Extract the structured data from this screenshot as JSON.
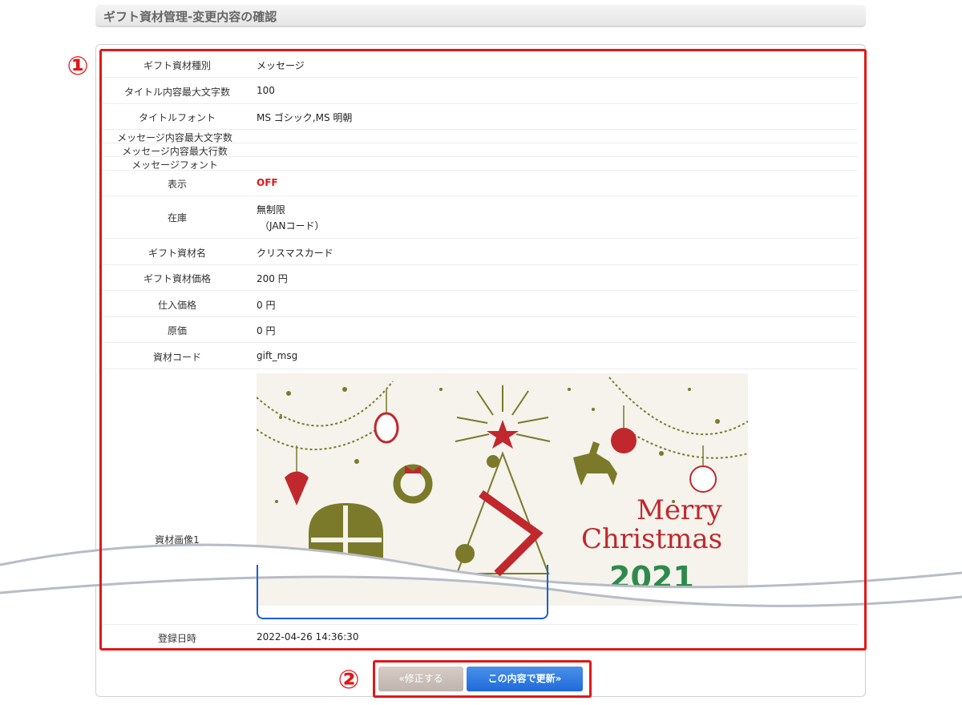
{
  "header": {
    "title": "ギフト資材管理-変更内容の確認"
  },
  "callouts": {
    "one": "①",
    "two": "②"
  },
  "rows": [
    {
      "label": "ギフト資材種別",
      "value": "メッセージ"
    },
    {
      "label": "タイトル内容最大文字数",
      "value": "100"
    },
    {
      "label": "タイトルフォント",
      "value": "MS ゴシック,MS 明朝"
    },
    {
      "label": "メッセージ内容最大文字数",
      "value": ""
    },
    {
      "label": "メッセージ内容最大行数",
      "value": ""
    },
    {
      "label": "メッセージフォント",
      "value": ""
    },
    {
      "label": "表示",
      "value": "OFF"
    },
    {
      "label": "在庫",
      "value": "無制限",
      "sub": "（JANコード）"
    },
    {
      "label": "ギフト資材名",
      "value": "クリスマスカード"
    },
    {
      "label": "ギフト資材価格",
      "value": "200 円"
    },
    {
      "label": "仕入価格",
      "value": "0 円"
    },
    {
      "label": "原価",
      "value": "0 円"
    },
    {
      "label": "資材コード",
      "value": "gift_msg"
    },
    {
      "label": "資材画像1",
      "value": ""
    },
    {
      "label": "登録日時",
      "value": "2022-04-26 14:36:30"
    }
  ],
  "image": {
    "line1": "Merry",
    "line2": "Christmas",
    "line3": "2021"
  },
  "buttons": {
    "back": "«修正する",
    "submit": "この内容で更新»"
  },
  "colors": {
    "highlight": "#e01818",
    "status_off": "#e01818",
    "primary_button": "#1f6ad8"
  }
}
